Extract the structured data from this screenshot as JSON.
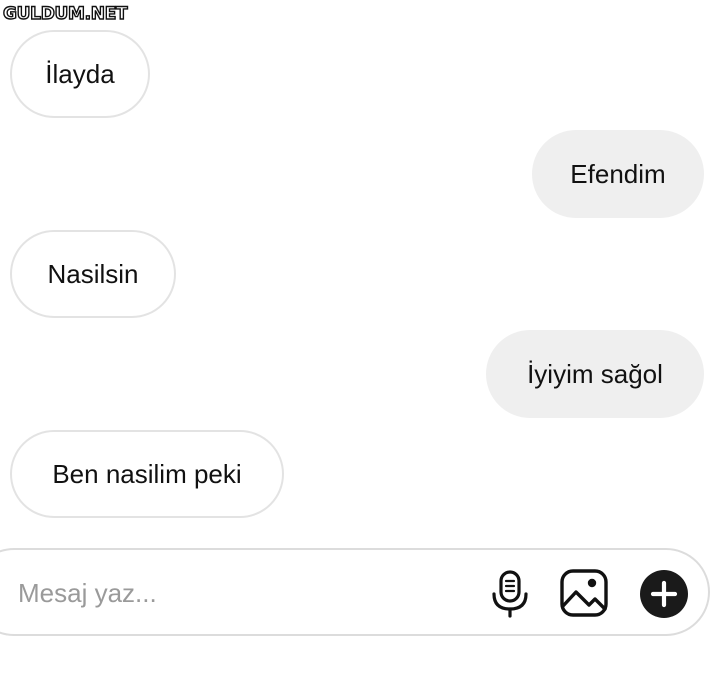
{
  "watermark": {
    "text": "GULDUM.NET"
  },
  "messages": [
    {
      "text": "İlayda",
      "direction": "incoming"
    },
    {
      "text": "Efendim",
      "direction": "outgoing"
    },
    {
      "text": "Nasilsin",
      "direction": "incoming"
    },
    {
      "text": "İyiyim sağol",
      "direction": "outgoing"
    },
    {
      "text": "Ben nasilim peki",
      "direction": "incoming"
    }
  ],
  "composer": {
    "placeholder": "Mesaj yaz...",
    "icons": [
      "microphone-icon",
      "image-icon",
      "plus-circle-icon"
    ]
  },
  "colors": {
    "incoming_border": "#e3e3e3",
    "outgoing_bg": "#efefef",
    "text": "#111111",
    "placeholder": "#9a9a9a",
    "add_button_bg": "#1a1a1a"
  }
}
